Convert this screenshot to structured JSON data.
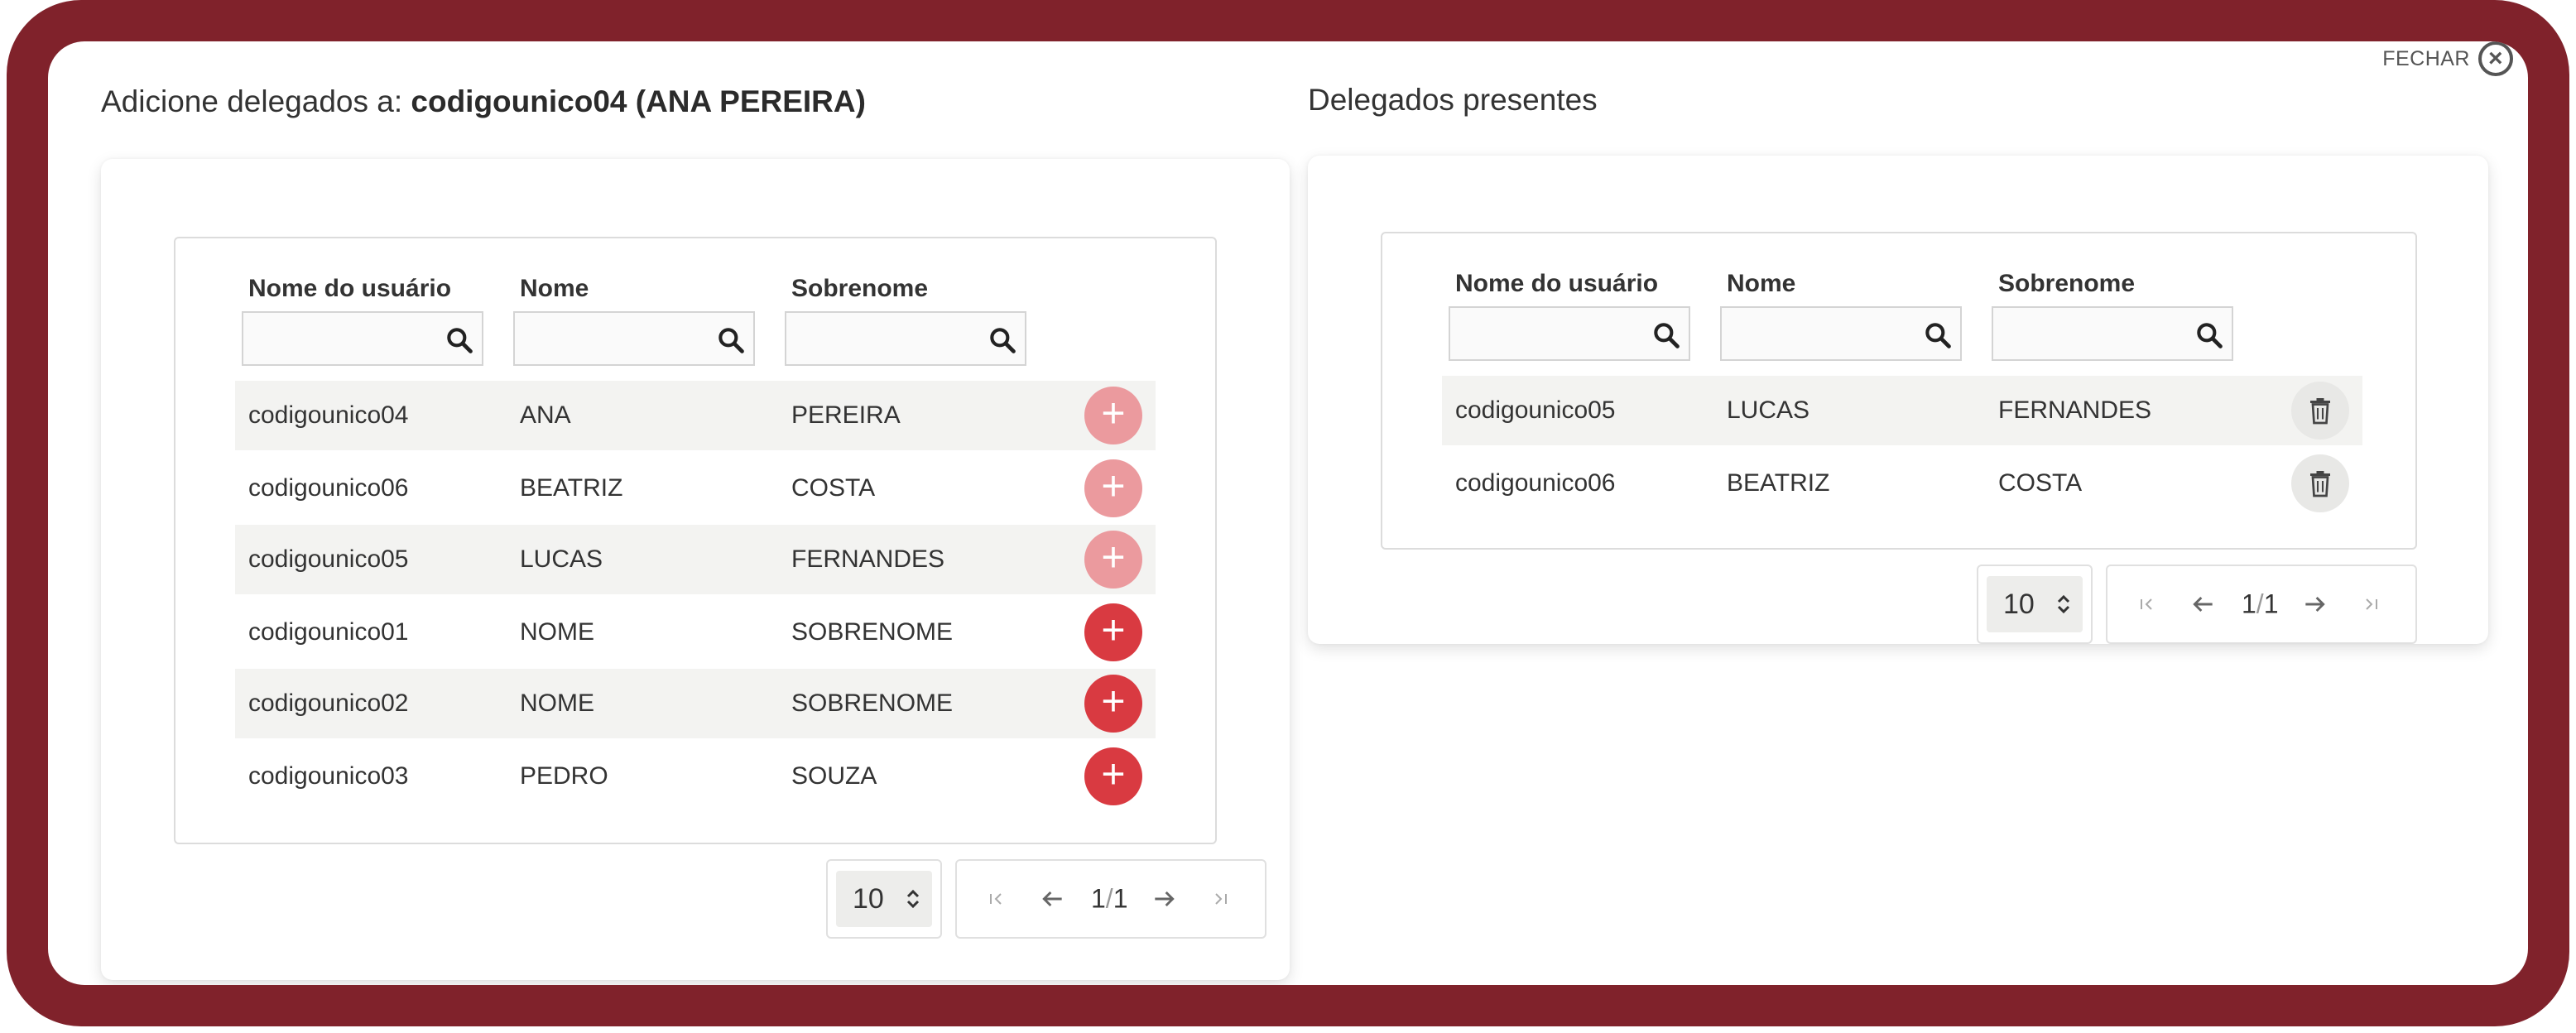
{
  "modal": {
    "close_label": "FECHAR"
  },
  "left": {
    "heading_prefix": "Adicione delegados a: ",
    "heading_target": "codigounico04 (ANA PEREIRA)",
    "columns": [
      "Nome do usuário",
      "Nome",
      "Sobrenome"
    ],
    "filters": [
      "",
      "",
      ""
    ],
    "rows": [
      {
        "username": "codigounico04",
        "first": "ANA",
        "last": "PEREIRA",
        "add_enabled": false
      },
      {
        "username": "codigounico06",
        "first": "BEATRIZ",
        "last": "COSTA",
        "add_enabled": false
      },
      {
        "username": "codigounico05",
        "first": "LUCAS",
        "last": "FERNANDES",
        "add_enabled": false
      },
      {
        "username": "codigounico01",
        "first": "NOME",
        "last": "SOBRENOME",
        "add_enabled": true
      },
      {
        "username": "codigounico02",
        "first": "NOME",
        "last": "SOBRENOME",
        "add_enabled": true
      },
      {
        "username": "codigounico03",
        "first": "PEDRO",
        "last": "SOUZA",
        "add_enabled": true
      }
    ],
    "page_size": "10",
    "page_current": "1",
    "page_total": "1"
  },
  "right": {
    "heading": "Delegados presentes",
    "columns": [
      "Nome do usuário",
      "Nome",
      "Sobrenome"
    ],
    "filters": [
      "",
      "",
      ""
    ],
    "rows": [
      {
        "username": "codigounico05",
        "first": "LUCAS",
        "last": "FERNANDES"
      },
      {
        "username": "codigounico06",
        "first": "BEATRIZ",
        "last": "COSTA"
      }
    ],
    "page_size": "10",
    "page_current": "1",
    "page_total": "1"
  },
  "colors": {
    "frame": "#80222b",
    "add_button": "#d93a41",
    "add_button_disabled": "#eb9a9e"
  },
  "icons": {
    "filter": "search-icon",
    "add": "plus-icon",
    "delete": "trash-icon",
    "close": "close-icon",
    "first": "first-page-icon",
    "prev": "arrow-left-icon",
    "next": "arrow-right-icon",
    "last": "last-page-icon",
    "size_toggle": "chevron-up-down-icon"
  }
}
